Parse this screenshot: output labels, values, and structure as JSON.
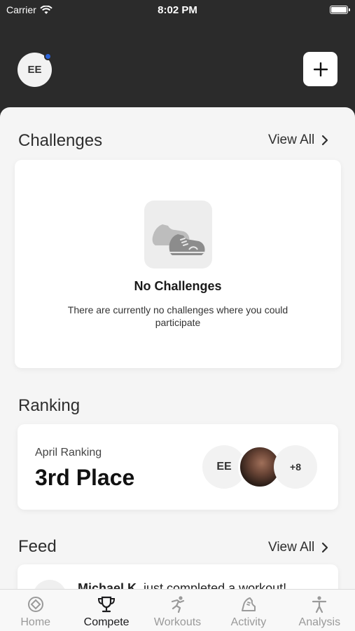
{
  "status_bar": {
    "carrier": "Carrier",
    "time": "8:02 PM"
  },
  "header": {
    "avatar_initials": "EE"
  },
  "challenges": {
    "title": "Challenges",
    "view_all": "View All",
    "empty_title": "No Challenges",
    "empty_description": "There are currently no challenges where you could participate"
  },
  "ranking": {
    "title": "Ranking",
    "label": "April Ranking",
    "value": "3rd Place",
    "participant_initials": "EE",
    "more_count": "+8"
  },
  "feed": {
    "title": "Feed",
    "view_all": "View All",
    "first_item_name": "Michael K.",
    "first_item_text": " just completed a workout!"
  },
  "tabbar": {
    "tabs": [
      {
        "label": "Home",
        "icon": "home-icon"
      },
      {
        "label": "Compete",
        "icon": "trophy-icon"
      },
      {
        "label": "Workouts",
        "icon": "workouts-icon"
      },
      {
        "label": "Activity",
        "icon": "activity-icon"
      },
      {
        "label": "Analysis",
        "icon": "analysis-icon"
      }
    ],
    "active_index": 1
  },
  "colors": {
    "header_bg": "#2b2b2b",
    "notification_dot": "#2a62d9",
    "active_tab": "#1c1c1e",
    "inactive_tab": "#9a9a9a"
  }
}
